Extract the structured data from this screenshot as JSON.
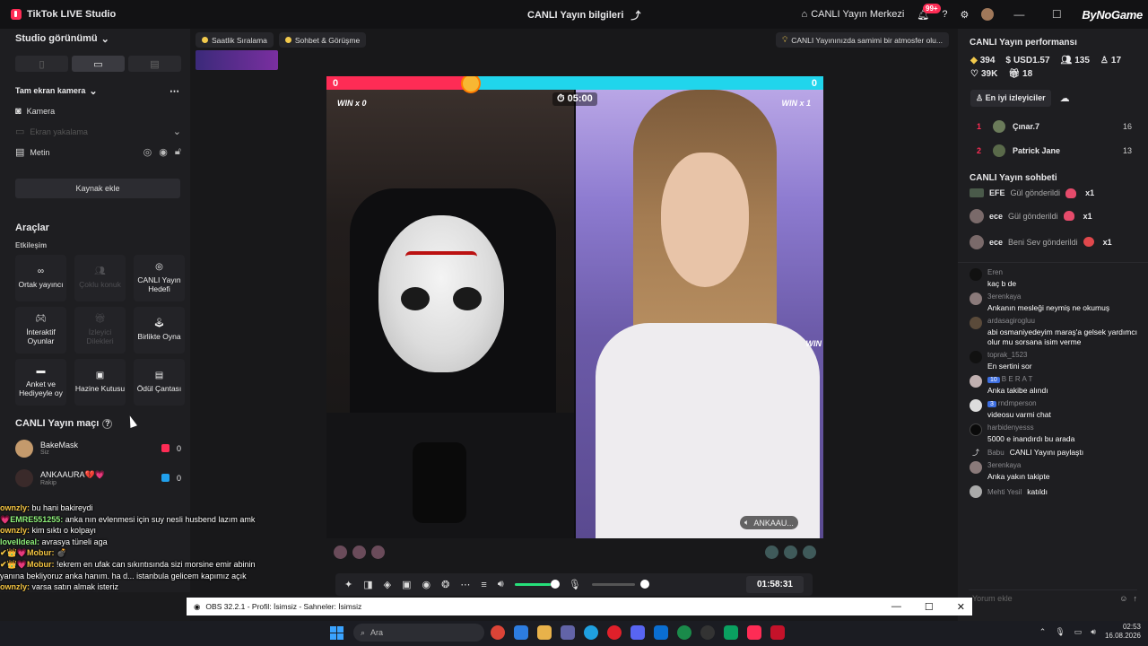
{
  "titlebar": {
    "app_title": "TikTok LIVE Studio",
    "center_title": "CANLI Yayın bilgileri",
    "live_center": "CANLI Yayın Merkezi",
    "notif_badge": "99+",
    "brand": "ByNoGame"
  },
  "left": {
    "studio_view": "Studio görünümü",
    "fullscreen_camera": "Tam ekran kamera",
    "sources": [
      {
        "label": "Kamera"
      },
      {
        "label": "Ekran yakalama"
      },
      {
        "label": "Metin"
      }
    ],
    "add_source": "Kaynak ekle",
    "tools_title": "Araçlar",
    "engagement": "Etkileşim",
    "tools": [
      {
        "label": "Ortak yayıncı",
        "icon": "link-icon"
      },
      {
        "label": "Çoklu konuk",
        "icon": "users-icon"
      },
      {
        "label": "CANLI Yayın Hedefi",
        "icon": "target-icon"
      },
      {
        "label": "İnteraktif Oyunlar",
        "icon": "gamepad-icon"
      },
      {
        "label": "İzleyici Dilekleri",
        "icon": "gift-icon"
      },
      {
        "label": "Birlikte Oyna",
        "icon": "joystick-icon"
      },
      {
        "label": "Anket ve Hediyeyle oy",
        "icon": "poll-icon"
      },
      {
        "label": "Hazine Kutusu",
        "icon": "treasure-icon"
      },
      {
        "label": "Ödül Çantası",
        "icon": "bag-icon"
      }
    ],
    "match_title": "CANLI Yayın maçı",
    "match": [
      {
        "name": "BakeMask",
        "role": "Siz",
        "score": "0",
        "color": "#fe2c55"
      },
      {
        "name": "ANKAAURA💔💗",
        "role": "Rakip",
        "score": "0",
        "color": "#20a0ec"
      }
    ]
  },
  "overlay_chat": [
    {
      "name": "ownzly:",
      "text": "bu hani bakireydi",
      "color": "#f5c542"
    },
    {
      "name": "💗EMRE551255:",
      "text": "anka nın evlenmesi için suy nesli husbend lazım amk",
      "color": "#8ef07a"
    },
    {
      "name": "ownzly:",
      "text": "kim sıktı o kolpayı",
      "color": "#f5c542"
    },
    {
      "name": "loveIIdeal:",
      "text": "avrasya tüneli aga",
      "color": "#8ef07a"
    },
    {
      "name": "✔👑💗Mobur:",
      "text": "💣",
      "color": "#f5c542"
    },
    {
      "name": "✔👑💗Mobur:",
      "text": "!ekrem en ufak can sıkıntısında sizi morsine emir abinin yanına bekliyoruz anka hanım. ha d... istanbula gelicem kapımız açık",
      "color": "#f5c542"
    },
    {
      "name": "ownzly:",
      "text": "varsa satın almak isteriz",
      "color": "#f5c542"
    }
  ],
  "center": {
    "chips": [
      "Saatlik Sıralama",
      "Sohbet & Görüşme"
    ],
    "tip": "CANLI Yayınınızda samimi bir atmosfer olu...",
    "pk_left": "0",
    "pk_right": "0",
    "win_left": "WIN x 0",
    "win_right": "WIN x 1",
    "timer": "05:00",
    "win_edge": "WIN",
    "opponent_tag": "ANKAAU...",
    "duration": "01:58:31"
  },
  "right": {
    "perf_title": "CANLI Yayın performansı",
    "stats": [
      {
        "icon": "diamond-icon",
        "value": "394"
      },
      {
        "icon": "coin-icon",
        "value": "USD1.57"
      },
      {
        "icon": "viewers-icon",
        "value": "135"
      },
      {
        "icon": "followers-icon",
        "value": "17"
      },
      {
        "icon": "heart-icon",
        "value": "39K"
      },
      {
        "icon": "gift-icon",
        "value": "18"
      }
    ],
    "top_viewers_tab": "En iyi izleyiciler",
    "top_viewers": [
      {
        "rank": "1",
        "name": "Çınar.7",
        "score": "16"
      },
      {
        "rank": "2",
        "name": "Patrick Jane",
        "score": "13"
      }
    ],
    "chat_title": "CANLI Yayın sohbeti",
    "gifts": [
      {
        "user": "EFE",
        "text": "Gül gönderildi",
        "count": "x1"
      },
      {
        "user": "ece",
        "text": "Gül gönderildi",
        "count": "x1"
      },
      {
        "user": "ece",
        "text": "Beni Sev gönderildi",
        "count": "x1"
      }
    ],
    "messages": [
      {
        "user": "Eren",
        "text": "kaç b de"
      },
      {
        "user": "3erenkaya",
        "text": "Ankanın mesleği neymiş ne okumuş"
      },
      {
        "user": "ardasagirogluu",
        "text": "abi osmaniyedeyim maraş'a gelsek yardımcı olur mu sorsana isim verme"
      },
      {
        "user": "toprak_1523",
        "text": "En sertini sor"
      },
      {
        "user": "B E R A T",
        "level": "10",
        "text": "Anka takibe alındı"
      },
      {
        "user": "rndmperson",
        "level": "3",
        "text": "videosu varmi chat"
      },
      {
        "user": "harbidenyesss",
        "text": "5000 e inandırdı bu arada"
      },
      {
        "user": "Babu",
        "text": "CANLI Yayını paylaştı"
      },
      {
        "user": "3erenkaya",
        "text": "Anka yakın takipte"
      },
      {
        "user": "Mehti Yesil",
        "text": "katıldı"
      }
    ],
    "comment_placeholder": "Yorum ekle"
  },
  "obs": {
    "title": "OBS 32.2.1 - Profil: İsimsiz - Sahneler: İsimsiz"
  },
  "taskbar": {
    "search": "Ara",
    "time": "02:53",
    "date": "16.08.2026"
  },
  "colors": {
    "accent": "#fe2c55",
    "cyan": "#20d5ec",
    "green": "#26e07a"
  }
}
